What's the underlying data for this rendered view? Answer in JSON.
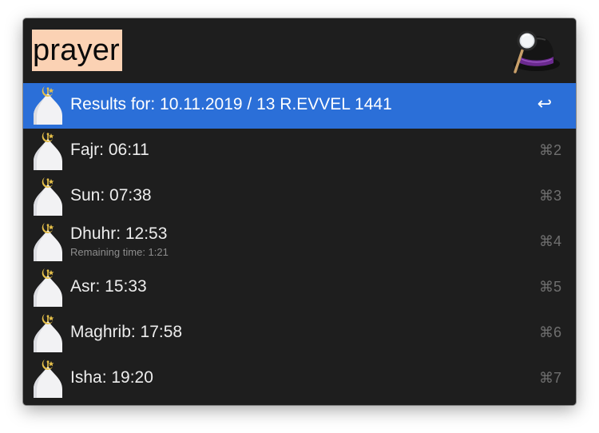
{
  "search": {
    "query": "prayer"
  },
  "app_icon": "alfred-hat-icon",
  "result_icon": "mosque-dome-icon",
  "selection_color": "#2b6fd8",
  "query_highlight_color": "#fbd2b4",
  "results": [
    {
      "title": "Results for: 10.11.2019 / 13 R.EVVEL 1441",
      "subtitle": "",
      "shortcut": "↩",
      "selected": true
    },
    {
      "title": "Fajr: 06:11",
      "subtitle": "",
      "shortcut": "⌘2",
      "selected": false
    },
    {
      "title": "Sun: 07:38",
      "subtitle": "",
      "shortcut": "⌘3",
      "selected": false
    },
    {
      "title": "Dhuhr: 12:53",
      "subtitle": "Remaining time: 1:21",
      "shortcut": "⌘4",
      "selected": false
    },
    {
      "title": "Asr: 15:33",
      "subtitle": "",
      "shortcut": "⌘5",
      "selected": false
    },
    {
      "title": "Maghrib: 17:58",
      "subtitle": "",
      "shortcut": "⌘6",
      "selected": false
    },
    {
      "title": "Isha: 19:20",
      "subtitle": "",
      "shortcut": "⌘7",
      "selected": false
    }
  ]
}
